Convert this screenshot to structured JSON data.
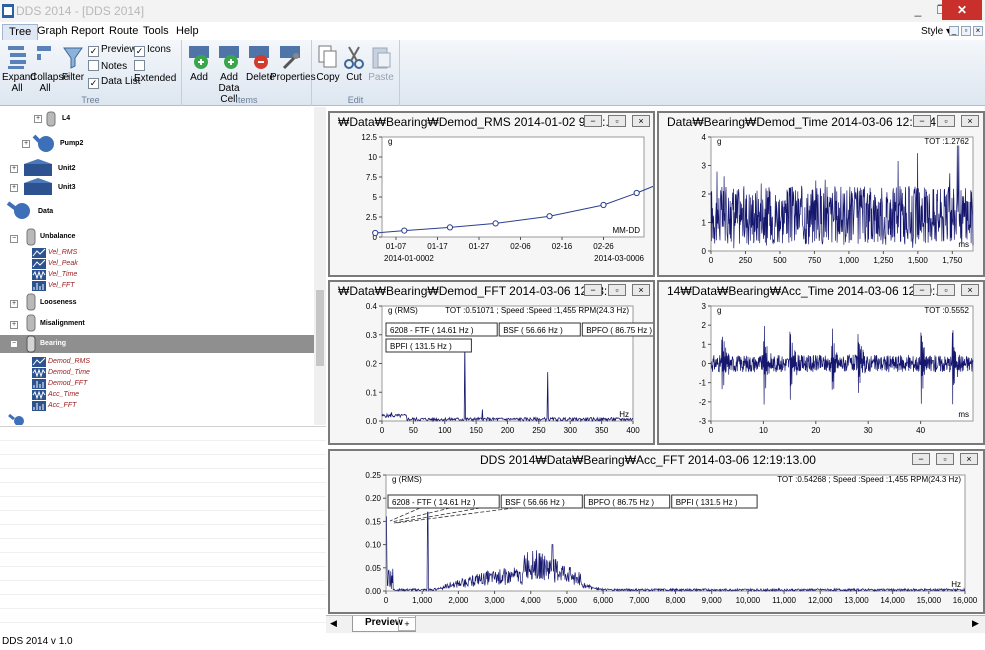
{
  "window": {
    "title": "DDS 2014 - [DDS 2014]",
    "minimize": "_",
    "maximize": "❐",
    "close": "✕"
  },
  "menu": {
    "items": [
      "Tree",
      "Graph",
      "Report",
      "Route",
      "Tools",
      "Help"
    ],
    "style_label": "Style ▾"
  },
  "ribbon": {
    "tree_group": {
      "label": "Tree",
      "expand_all": "Expand All",
      "collapse_all": "Collapse All",
      "filter": "Filter",
      "preview": "Preview",
      "notes": "Notes",
      "data_list": "Data List",
      "icons": "Icons",
      "extended": "Extended"
    },
    "items_group": {
      "label": "Items",
      "add": "Add",
      "add_data_cell": "Add Data Cell",
      "delete": "Delete",
      "properties": "Properties"
    },
    "edit_group": {
      "label": "Edit",
      "copy": "Copy",
      "cut": "Cut",
      "paste": "Paste"
    }
  },
  "tree": {
    "nodes": [
      {
        "label": "L4",
        "kind": "node"
      },
      {
        "label": "Pump2",
        "kind": "node"
      },
      {
        "label": "Unit2",
        "kind": "node"
      },
      {
        "label": "Unit3",
        "kind": "node"
      },
      {
        "label": "Data",
        "kind": "node"
      },
      {
        "label": "Unbalance",
        "kind": "node"
      },
      {
        "label": "Vel_RMS",
        "kind": "leaf"
      },
      {
        "label": "Vel_Peak",
        "kind": "leaf"
      },
      {
        "label": "Vel_Time",
        "kind": "leaf"
      },
      {
        "label": "Vel_FFT",
        "kind": "leaf"
      },
      {
        "label": "Looseness",
        "kind": "node"
      },
      {
        "label": "Misalignment",
        "kind": "node"
      },
      {
        "label": "Bearing",
        "kind": "selected"
      },
      {
        "label": "Demod_RMS",
        "kind": "leaf"
      },
      {
        "label": "Demod_Time",
        "kind": "leaf"
      },
      {
        "label": "Demod_FFT",
        "kind": "leaf"
      },
      {
        "label": "Acc_Time",
        "kind": "leaf"
      },
      {
        "label": "Acc_FFT",
        "kind": "leaf"
      }
    ]
  },
  "panels": {
    "demod_rms": {
      "title": "₩Data₩Bearing₩Demod_RMS     2014-01-02   9:30:..."
    },
    "demod_time": {
      "title": "Data₩Bearing₩Demod_Time     2014-03-06   12:18:4..."
    },
    "demod_fft": {
      "title": "₩Data₩Bearing₩Demod_FFT     2014-03-06   12:18:..."
    },
    "acc_time": {
      "title": "14₩Data₩Bearing₩Acc_Time     2014-03-06   12:19:..."
    },
    "acc_fft": {
      "title": "DDS 2014₩Data₩Bearing₩Acc_FFT     2014-03-06   12:19:13.00"
    }
  },
  "chart_data": [
    {
      "type": "line",
      "name": "Demod_RMS",
      "ylabel": "g",
      "ylim": [
        0,
        12.5
      ],
      "yticks": [
        0,
        2.5,
        5.0,
        7.5,
        10.0,
        12.5
      ],
      "xticks": [
        "01-07",
        "01-17",
        "01-27",
        "02-06",
        "02-16",
        "02-26"
      ],
      "x_start_label": "2014-01-0002",
      "x_end_label": "2014-03-0006",
      "x_format": "MM-DD",
      "x": [
        "01-02",
        "01-09",
        "01-20",
        "01-31",
        "02-13",
        "02-26",
        "03-06",
        "03-26"
      ],
      "values": [
        0.5,
        0.8,
        1.2,
        1.7,
        2.6,
        4.0,
        5.5,
        9.7
      ]
    },
    {
      "type": "line",
      "name": "Demod_Time",
      "ylabel": "g",
      "ylim": [
        0,
        4
      ],
      "yticks": [
        0,
        1,
        2,
        3,
        4
      ],
      "xlabel": "ms",
      "xlim": [
        0,
        1900
      ],
      "xticks": [
        "0",
        "250",
        "500",
        "750",
        "1,000",
        "1,250",
        "1,500",
        "1,750"
      ],
      "annotation": "TOT :1.2762",
      "description": "dense noise-like signal between ~0.3 and ~3.4 g, centered ~1.2 g"
    },
    {
      "type": "line",
      "name": "Demod_FFT",
      "ylabel": "g  (RMS)",
      "ylim": [
        0,
        0.4
      ],
      "yticks": [
        0.0,
        0.1,
        0.2,
        0.3,
        0.4
      ],
      "xlabel": "Hz",
      "xlim": [
        0,
        400
      ],
      "xticks": [
        "0",
        "50",
        "100",
        "150",
        "200",
        "250",
        "300",
        "350",
        "400"
      ],
      "annotation": "TOT :0.51071 ;  Speed :Speed :1,455 RPM(24.3 Hz)",
      "markers": [
        "6208 - FTF  ( 14.61 Hz )",
        "BSF  ( 56.66 Hz )",
        "BPFO  ( 86.75 Hz )",
        "BPFI  ( 131.5 Hz )"
      ],
      "peaks": [
        {
          "x": 132,
          "y": 0.27
        },
        {
          "x": 264,
          "y": 0.17
        },
        {
          "x": 160,
          "y": 0.04
        },
        {
          "x": 15,
          "y": 0.03
        }
      ]
    },
    {
      "type": "line",
      "name": "Acc_Time",
      "ylabel": "g",
      "ylim": [
        -3,
        3
      ],
      "yticks": [
        -3,
        -2,
        -1,
        0,
        1,
        2,
        3
      ],
      "xlabel": "ms",
      "xlim": [
        0,
        50
      ],
      "xticks": [
        "0",
        "10",
        "20",
        "30",
        "40"
      ],
      "annotation": "TOT :0.5552",
      "impulses_at_ms": [
        2,
        10,
        15,
        23,
        28,
        40,
        46
      ]
    },
    {
      "type": "line",
      "name": "Acc_FFT",
      "ylabel": "g  (RMS)",
      "ylim": [
        0,
        0.25
      ],
      "yticks": [
        0.0,
        0.05,
        0.1,
        0.15,
        0.2,
        0.25
      ],
      "xlabel": "Hz",
      "xlim": [
        0,
        16000
      ],
      "xticks": [
        "0",
        "1,000",
        "2,000",
        "3,000",
        "4,000",
        "5,000",
        "6,000",
        "7,000",
        "8,000",
        "9,000",
        "10,000",
        "11,000",
        "12,000",
        "13,000",
        "14,000",
        "15,000",
        "16,000"
      ],
      "annotation": "TOT :0.54268 ;  Speed :Speed :1,455 RPM(24.3 Hz)",
      "markers": [
        "6208 - FTF  ( 14.61 Hz )",
        "BSF  ( 56.66 Hz )",
        "BPFO  ( 86.75 Hz )",
        "BPFI  ( 131.5 Hz )"
      ],
      "peaks": [
        {
          "x": 0,
          "y": 0.16
        },
        {
          "x": 1150,
          "y": 0.17
        },
        {
          "x": 4600,
          "y": 0.1
        }
      ]
    }
  ],
  "tabs": {
    "preview": "Preview",
    "add": "+"
  },
  "status": {
    "text": "DDS 2014 v 1.0"
  }
}
